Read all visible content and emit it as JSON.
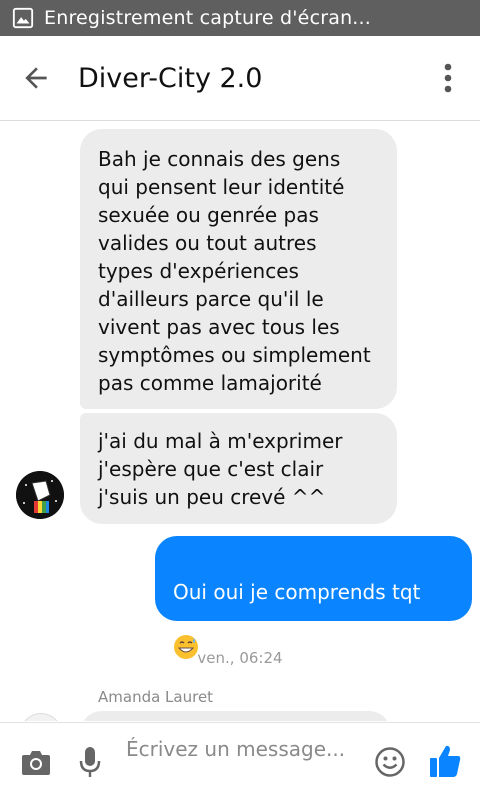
{
  "status_bar": {
    "notification_text": "Enregistrement capture d'écran...",
    "icon": "image-icon"
  },
  "header": {
    "title": "Diver-City 2.0",
    "back_icon": "arrow-left-icon",
    "menu_icon": "more-vert-icon"
  },
  "messages": [
    {
      "direction": "incoming",
      "text": "Bah je connais des gens\nqui pensent leur identité\nsexuée ou genrée pas\nvalides ou tout autres\ntypes d'expériences\nd'ailleurs parce qu'il le\nvivent pas avec tous les\nsymptômes ou simplement\npas comme lamajorité"
    },
    {
      "direction": "incoming",
      "text": "j'ai du mal à m'exprimer\nj'espère que c'est clair\nj'suis un peu crevé ^^"
    },
    {
      "direction": "outgoing",
      "text": "Oui oui je comprends tqt",
      "emoji": "grinning-sweat-emoji"
    }
  ],
  "timestamp": "ven., 06:24",
  "next_sender": "Amanda Lauret",
  "composer": {
    "placeholder": "Écrivez un message...",
    "camera_icon": "camera-icon",
    "mic_icon": "microphone-icon",
    "emoji_icon": "smiley-icon",
    "like_icon": "thumbs-up-icon"
  },
  "colors": {
    "status_bar": "#5f5f5f",
    "incoming_bubble": "#ececec",
    "outgoing_bubble": "#0a84ff",
    "accent": "#0a84ff"
  }
}
